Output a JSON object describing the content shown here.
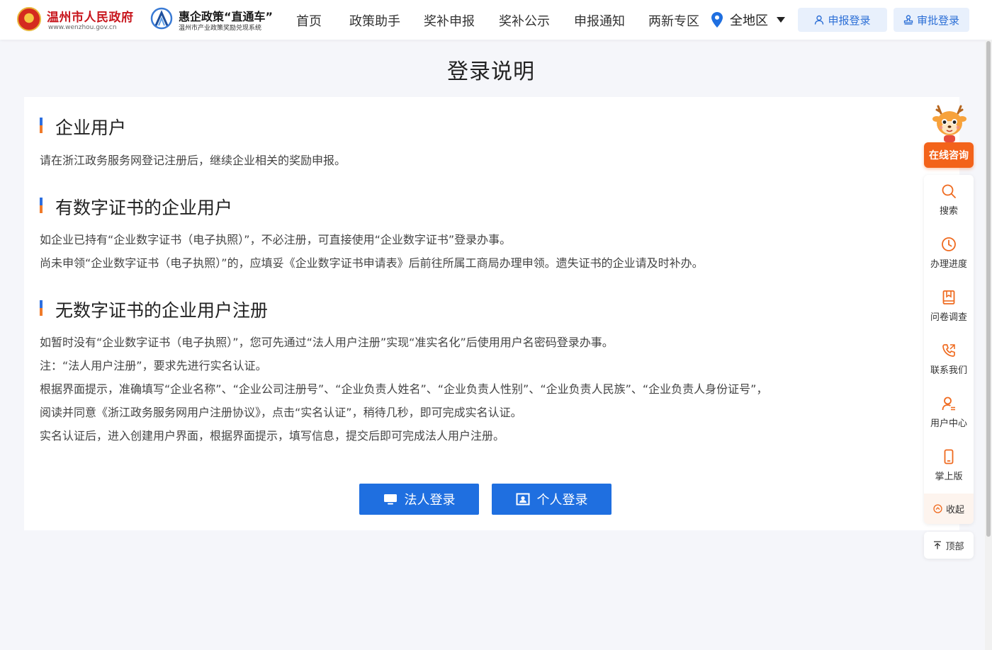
{
  "header": {
    "gov_logo": {
      "title": "温州市人民政府",
      "subtitle": "www.wenzhou.gov.cn"
    },
    "policy_logo": {
      "title": "惠企政策“直通车”",
      "subtitle": "温州市产业政策奖励兑现系统"
    },
    "nav": [
      "首页",
      "政策助手",
      "奖补申报",
      "奖补公示",
      "申报通知",
      "两新专区"
    ],
    "region": {
      "label": "全地区",
      "icon": "location-pin-icon"
    },
    "buttons": {
      "apply_login": "申报登录",
      "approve_login": "审批登录"
    }
  },
  "page": {
    "title": "登录说明"
  },
  "sections": [
    {
      "heading": "企业用户",
      "paragraphs": [
        "请在浙江政务服务网登记注册后，继续企业相关的奖励申报。"
      ]
    },
    {
      "heading": "有数字证书的企业用户",
      "paragraphs": [
        "如企业已持有“企业数字证书（电子执照）”，不必注册，可直接使用“企业数字证书”登录办事。",
        "尚未申领“企业数字证书（电子执照）”的，应填妥《企业数字证书申请表》后前往所属工商局办理申领。遗失证书的企业请及时补办。"
      ]
    },
    {
      "heading": "无数字证书的企业用户注册",
      "paragraphs": [
        "如暂时没有“企业数字证书（电子执照）”，您可先通过“法人用户注册”实现“准实名化”后使用用户名密码登录办事。",
        "注：“法人用户注册”，要求先进行实名认证。",
        "根据界面提示，准确填写“企业名称”、“企业公司注册号”、“企业负责人姓名”、“企业负责人性别”、“企业负责人民族”、“企业负责人身份证号”，",
        "阅读并同意《浙江政务服务网用户注册协议》，点击“实名认证”，稍待几秒，即可完成实名认证。",
        "实名认证后，进入创建用户界面，根据界面提示，填写信息，提交后即可完成法人用户注册。"
      ]
    }
  ],
  "actions": {
    "legal_login": "法人登录",
    "personal_login": "个人登录"
  },
  "sidebar": {
    "consult": "在线咨询",
    "items": [
      {
        "label": "搜索",
        "icon": "search-icon"
      },
      {
        "label": "办理进度",
        "icon": "clock-icon"
      },
      {
        "label": "问卷调查",
        "icon": "book-icon"
      },
      {
        "label": "联系我们",
        "icon": "phone-icon"
      },
      {
        "label": "用户中心",
        "icon": "user-icon"
      },
      {
        "label": "掌上版",
        "icon": "mobile-icon"
      }
    ],
    "collapse": "收起",
    "top": "顶部"
  },
  "colors": {
    "primary": "#1f6fe0",
    "accent_orange": "#f3631a",
    "gov_red": "#c8161d"
  }
}
